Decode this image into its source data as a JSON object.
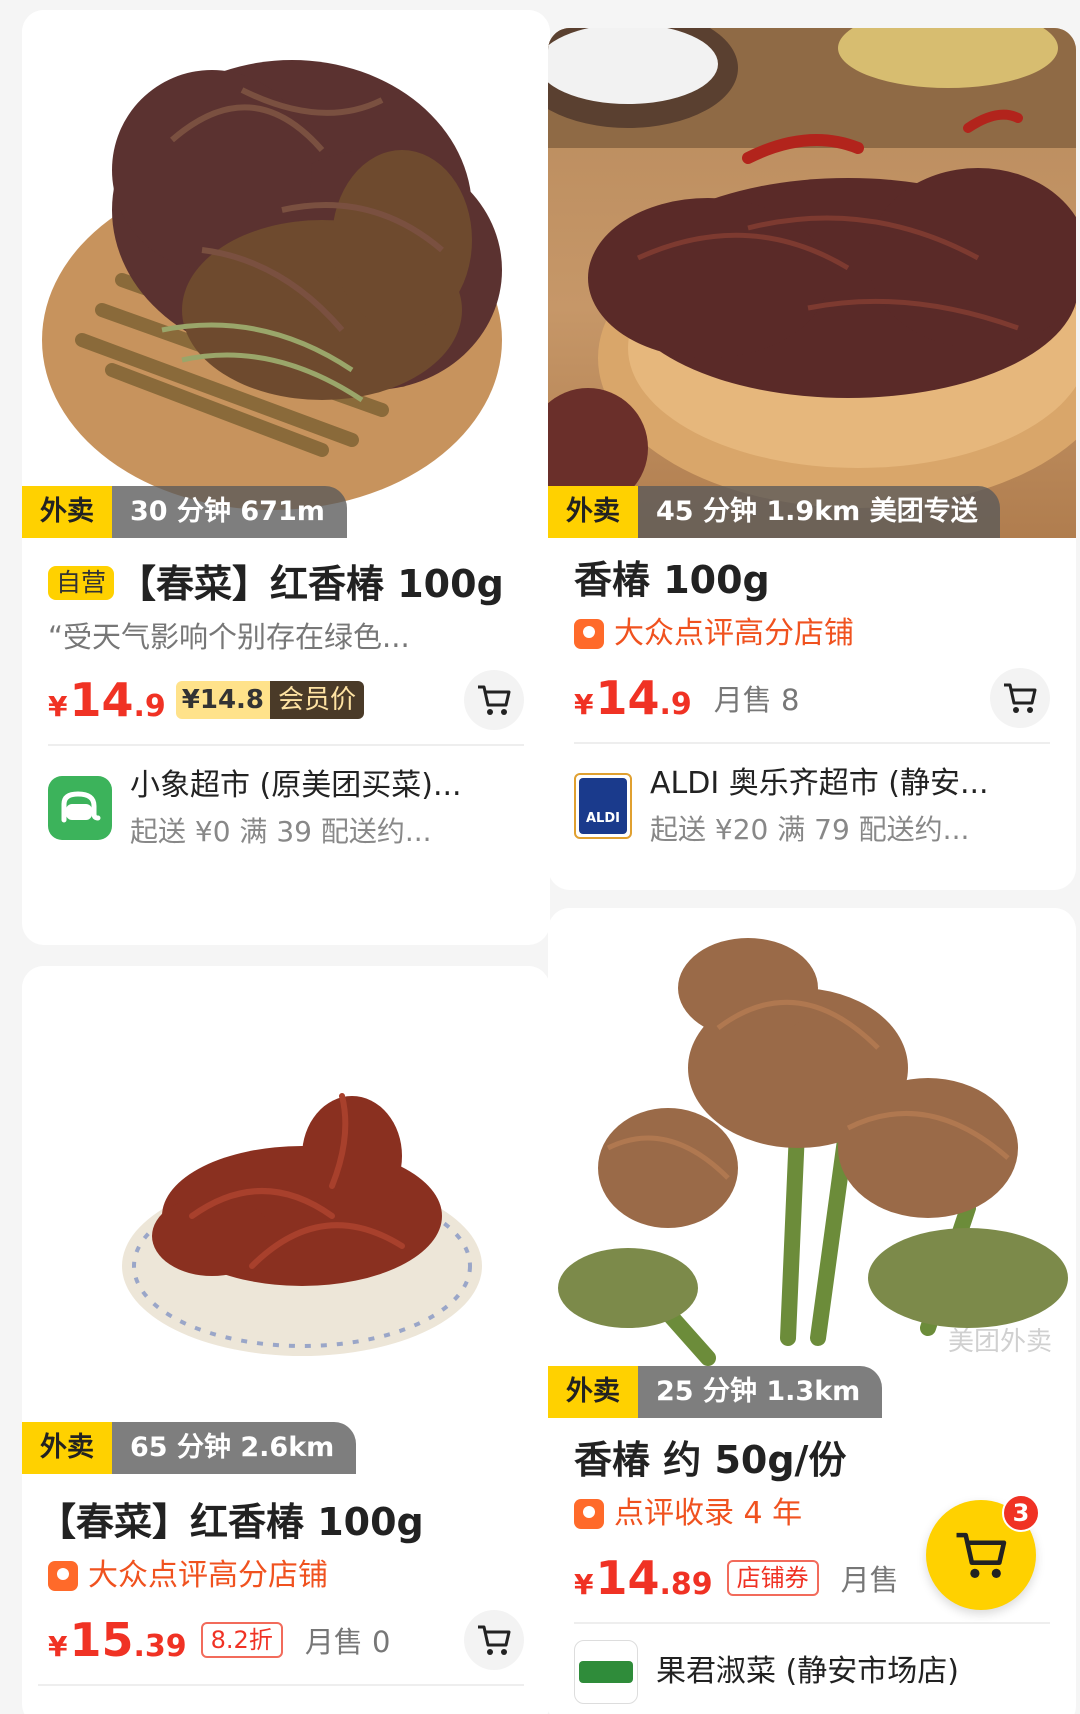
{
  "colors": {
    "price": "#f03224",
    "accent_yellow": "#ffd100",
    "dianping_orange": "#f0521f"
  },
  "products": [
    {
      "eta": {
        "mode": "外卖",
        "info": "30 分钟  671m"
      },
      "self_badge": "自营",
      "title": "【春菜】红香椿 100g",
      "subtitle": "“受天气影响个别存在绿色...",
      "price": {
        "symbol": "¥",
        "int": "14",
        "dec": ".9"
      },
      "member_price": {
        "value": "¥14.8",
        "label": "会员价"
      },
      "store": {
        "name": "小象超市 (原美团买菜)...",
        "meta": "起送 ¥0   满 39 配送约..."
      }
    },
    {
      "eta": {
        "mode": "外卖",
        "info": "45 分钟  1.9km  美团专送"
      },
      "title": "香椿 100g",
      "dianping": "大众点评高分店铺",
      "price": {
        "symbol": "¥",
        "int": "14",
        "dec": ".9"
      },
      "sold": "月售 8",
      "store": {
        "name": "ALDI 奥乐齐超市 (静安...",
        "meta": "起送 ¥20   满 79 配送约...",
        "logo_text": "ALDI"
      }
    },
    {
      "eta": {
        "mode": "外卖",
        "info": "65 分钟  2.6km"
      },
      "title": "【春菜】红香椿 100g",
      "dianping": "大众点评高分店铺",
      "price": {
        "symbol": "¥",
        "int": "15",
        "dec": ".39"
      },
      "discount": "8.2折",
      "sold": "月售 0"
    },
    {
      "eta": {
        "mode": "外卖",
        "info": "25 分钟  1.3km"
      },
      "watermark": "美团外卖",
      "title": "香椿 约 50g/份",
      "dianping": "点评收录 4 年",
      "price": {
        "symbol": "¥",
        "int": "14",
        "dec": ".89"
      },
      "discount": "店铺券",
      "sold": "月售",
      "store": {
        "name": "果君淑菜 (静安市场店)"
      }
    }
  ],
  "cart": {
    "count": "3"
  }
}
